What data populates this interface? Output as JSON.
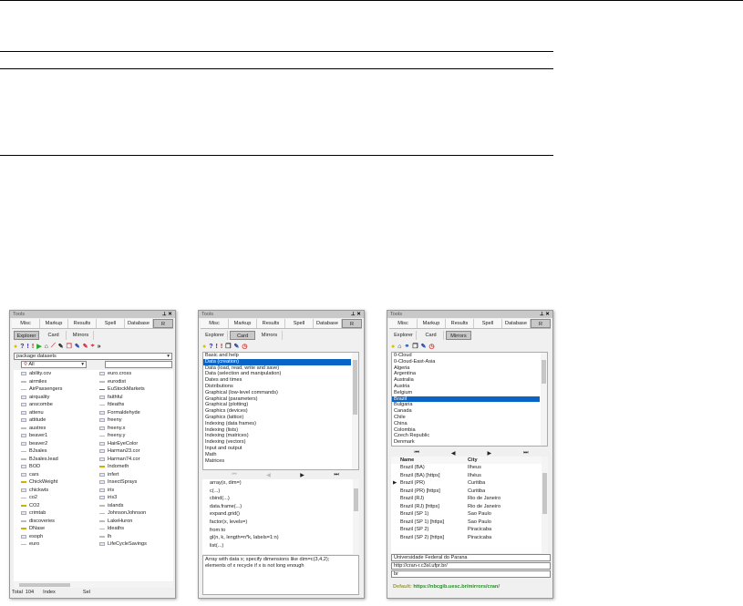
{
  "tools_title": "Tools",
  "tabs": [
    "Misc",
    "Markup",
    "Results",
    "Spell",
    "Database",
    "R"
  ],
  "subtabs": [
    "Explorer",
    "Card",
    "Mirrors"
  ],
  "explorer": {
    "package": "package:datasets",
    "filter": "All",
    "search": "",
    "col1": [
      [
        "ability.cov",
        "t"
      ],
      [
        "airmiles",
        "v"
      ],
      [
        "AirPassengers",
        "v"
      ],
      [
        "airquality",
        "t"
      ],
      [
        "anscombe",
        "t"
      ],
      [
        "attenu",
        "t"
      ],
      [
        "attitude",
        "t"
      ],
      [
        "austres",
        "v"
      ],
      [
        "beaver1",
        "t"
      ],
      [
        "beaver2",
        "t"
      ],
      [
        "BJsales",
        "v"
      ],
      [
        "BJsales.lead",
        "v"
      ],
      [
        "BOD",
        "t"
      ],
      [
        "cars",
        "t"
      ],
      [
        "ChickWeight",
        "y"
      ],
      [
        "chickwts",
        "t"
      ],
      [
        "co2",
        "v"
      ],
      [
        "CO2",
        "y"
      ],
      [
        "crimtab",
        "t"
      ],
      [
        "discoveries",
        "v"
      ],
      [
        "DNase",
        "y"
      ],
      [
        "esoph",
        "t"
      ],
      [
        "euro",
        "v"
      ]
    ],
    "col2": [
      [
        "euro.cross",
        "t"
      ],
      [
        "eurodist",
        "v"
      ],
      [
        "EuStockMarkets",
        "g"
      ],
      [
        "faithful",
        "t"
      ],
      [
        "fdeaths",
        "v"
      ],
      [
        "Formaldehyde",
        "t"
      ],
      [
        "freeny",
        "t"
      ],
      [
        "freeny.x",
        "t"
      ],
      [
        "freeny.y",
        "v"
      ],
      [
        "HairEyeColor",
        "t"
      ],
      [
        "Harman23.cor",
        "t"
      ],
      [
        "Harman74.cor",
        "t"
      ],
      [
        "Indometh",
        "y"
      ],
      [
        "infert",
        "t"
      ],
      [
        "InsectSprays",
        "t"
      ],
      [
        "iris",
        "t"
      ],
      [
        "iris3",
        "t"
      ],
      [
        "islands",
        "v"
      ],
      [
        "JohnsonJohnson",
        "v"
      ],
      [
        "LakeHuron",
        "v"
      ],
      [
        "ldeaths",
        "v"
      ],
      [
        "lh",
        "v"
      ],
      [
        "LifeCycleSavings",
        "t"
      ]
    ],
    "status": [
      "Total",
      "104",
      "Index",
      "Sel"
    ]
  },
  "card": {
    "categories": [
      "Basic and help",
      "Data (creation)",
      "Data (load, read, write and save)",
      "Data (selection and manipulation)",
      "Dates and times",
      "Distributions",
      "Graphical (low-level commands)",
      "Graphical (parameters)",
      "Graphical (plotting)",
      "Graphics (devices)",
      "Graphics (lattice)",
      "Indexing (data frames)",
      "Indexing (lists)",
      "Indexing (matrices)",
      "Indexing (vectors)",
      "Input and output",
      "Math",
      "Matrices"
    ],
    "selected": 1,
    "functions": [
      "array(x, dim=)",
      "c(...)",
      "cbind(...)",
      "data.frame(...)",
      "expand.grid()",
      "factor(x, levels=)",
      "from:to",
      "gl(n, k, length=n*k, labels=1:n)",
      "list(...)"
    ],
    "description": "Array with data x; specify dimensions like dim=c(3,4,2); elements of x recycle if x is not long enough"
  },
  "mirrors": {
    "countries": [
      "0-Cloud",
      "0-Cloud-East-Asia",
      "Algeria",
      "Argentina",
      "Australia",
      "Austria",
      "Belgium",
      "Brazil",
      "Bulgaria",
      "Canada",
      "Chile",
      "China",
      "Colombia",
      "Czech Republic",
      "Denmark"
    ],
    "selected": 7,
    "columns": [
      "Name",
      "City"
    ],
    "rows": [
      [
        "Brazil (BA)",
        "Ilheus"
      ],
      [
        "Brazil (BA) [https]",
        "Ilhéus"
      ],
      [
        "Brazil (PR)",
        "Curitiba"
      ],
      [
        "Brazil (PR) [https]",
        "Curitiba"
      ],
      [
        "Brazil (RJ)",
        "Rio de Janeiro"
      ],
      [
        "Brazil (RJ) [https]",
        "Rio de Janeiro"
      ],
      [
        "Brazil (SP 1)",
        "Sao Paulo"
      ],
      [
        "Brazil (SP 1) [https]",
        "Sao Paulo"
      ],
      [
        "Brazil (SP 2)",
        "Piracicaba"
      ],
      [
        "Brazil (SP 2) [https]",
        "Piracicaba"
      ]
    ],
    "current_row": 2,
    "host": "Universidade Federal do Parana",
    "url": "http://cran-r.c3sl.ufpr.br/",
    "code": "br",
    "default_label": "Default:",
    "default_url": "https://nbcgib.uesc.br/mirrors/cran/"
  },
  "colors": {
    "selection": "#0a64c8",
    "default_url": "#2a8a2a"
  }
}
